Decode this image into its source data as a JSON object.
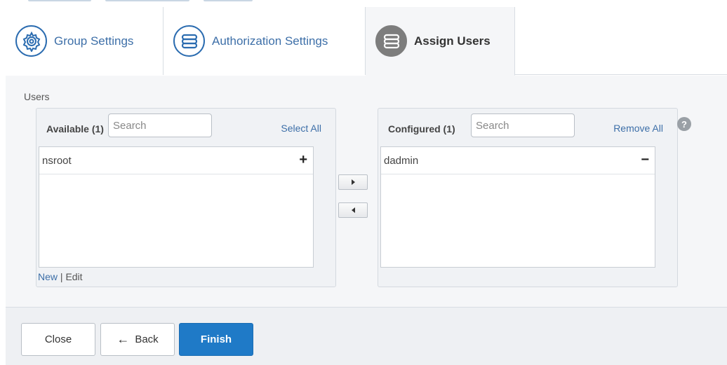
{
  "tabs": [
    {
      "label": "Group Settings",
      "icon": "gear-icon",
      "active": false
    },
    {
      "label": "Authorization Settings",
      "icon": "stack-icon",
      "active": false
    },
    {
      "label": "Assign Users",
      "icon": "stack-icon",
      "active": true
    }
  ],
  "users": {
    "heading": "Users",
    "available": {
      "title": "Available (1)",
      "search_placeholder": "Search",
      "bulk_link": "Select All",
      "items": [
        {
          "name": "nsroot",
          "action": "+"
        }
      ],
      "footer": {
        "new": "New",
        "separator": "|",
        "edit": "Edit"
      }
    },
    "configured": {
      "title": "Configured (1)",
      "search_placeholder": "Search",
      "bulk_link": "Remove All",
      "items": [
        {
          "name": "dadmin",
          "action": "−"
        }
      ]
    },
    "help": "?"
  },
  "footer": {
    "close": "Close",
    "back": "Back",
    "back_arrow": "←",
    "finish": "Finish"
  },
  "colors": {
    "link": "#3d6fa8",
    "primary_button": "#1f7ac7",
    "active_tab_icon": "#7d7d7d"
  }
}
